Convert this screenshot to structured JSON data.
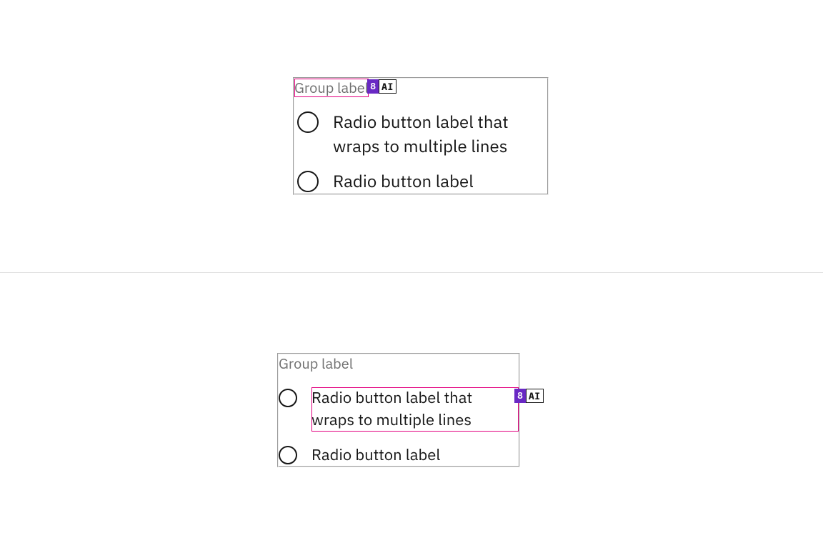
{
  "annotation": {
    "number": "8",
    "ai": "AI"
  },
  "top_group": {
    "label": "Group label",
    "items": [
      {
        "label": "Radio button label that wraps to multiple lines"
      },
      {
        "label": "Radio button label"
      }
    ]
  },
  "bottom_group": {
    "label": "Group label",
    "items": [
      {
        "label": "Radio button label that wraps to multiple lines"
      },
      {
        "label": "Radio button label"
      }
    ]
  }
}
